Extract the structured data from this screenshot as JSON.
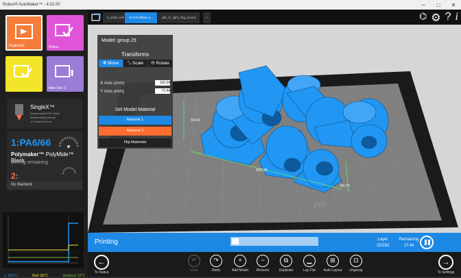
{
  "window": {
    "title": "Robox® AutoMaker™ - 4.02.00",
    "minimize": "─",
    "maximize": "□",
    "close": "✕"
  },
  "sidebar": {
    "tiles": [
      {
        "label": "Neglected",
        "color": "#f57c3a"
      },
      {
        "label": "Robox",
        "color": "#e055d8"
      },
      {
        "label": "",
        "color": "#f3e52a"
      },
      {
        "label": "New Gen 2",
        "color": "#9b7cd6"
      }
    ],
    "head": {
      "name": "SingleX™",
      "lines": [
        "Experimental FFF Head",
        "Internal Baby Nozzle",
        "1x Filament Feed"
      ]
    },
    "material1": {
      "slot": "1:PA6/66",
      "brand": "Polymaker™",
      "name": "PolyMide™ Black",
      "remaining": "0m /0g remaining"
    },
    "material2": {
      "slot": "2:",
      "status": "No filament"
    },
    "temps": {
      "nozzle": "1: 250°C",
      "bed": "Bed: 82°C",
      "ambient": "Ambient: 32°C"
    }
  },
  "tabs": [
    {
      "label": "a_chain_link",
      "active": false
    },
    {
      "label": "2x Full Elbow cr...",
      "active": true
    },
    {
      "label": "qfd_cc_light_ring_mount",
      "active": false
    },
    {
      "label": "+",
      "active": false
    }
  ],
  "top_icons": [
    "hide-icon",
    "gear-icon",
    "help-icon",
    "info-icon"
  ],
  "model_panel": {
    "title": "Model: group 25",
    "section": "Transforms",
    "tools": [
      "Move",
      "Scale",
      "Rotate"
    ],
    "active_tool": "Move",
    "x_label": "X Axis (mm)",
    "x_value": "132.34",
    "y_label": "Y Axis (mm)",
    "y_value": "72.44",
    "material_heading": "Set Model Material",
    "mat1_btn": "Material 1",
    "mat2_btn": "Material 2",
    "flip_btn": "Flip Materials",
    "mat1_color": "#1e88e5",
    "mat2_color": "#ff6d2e"
  },
  "viewport": {
    "dim_a": "59.60",
    "dim_b": "219.25",
    "dim_c": "83.77",
    "bed_logo": "pro",
    "model_color": "#2196f3"
  },
  "print": {
    "status": "Printing",
    "progress": 0.08,
    "layer_label": "Layer",
    "layer_value": "22/292",
    "remaining_label": "Remaining",
    "remaining_value": "17:44"
  },
  "toolbar": {
    "back": "To Status",
    "buttons": [
      {
        "label": "Undo",
        "icon": "↶",
        "disabled": true
      },
      {
        "label": "Redo",
        "icon": "↷",
        "disabled": false
      },
      {
        "label": "Add Model",
        "icon": "+",
        "disabled": false
      },
      {
        "label": "Remove",
        "icon": "−",
        "disabled": false
      },
      {
        "label": "Duplicate",
        "icon": "⧉",
        "disabled": false
      },
      {
        "label": "Lay Flat",
        "icon": "▁",
        "disabled": false
      },
      {
        "label": "Auto Layout",
        "icon": "⊞",
        "disabled": false
      },
      {
        "label": "Ungroup",
        "icon": "⊡",
        "disabled": false
      }
    ],
    "forward": "To Settings"
  }
}
